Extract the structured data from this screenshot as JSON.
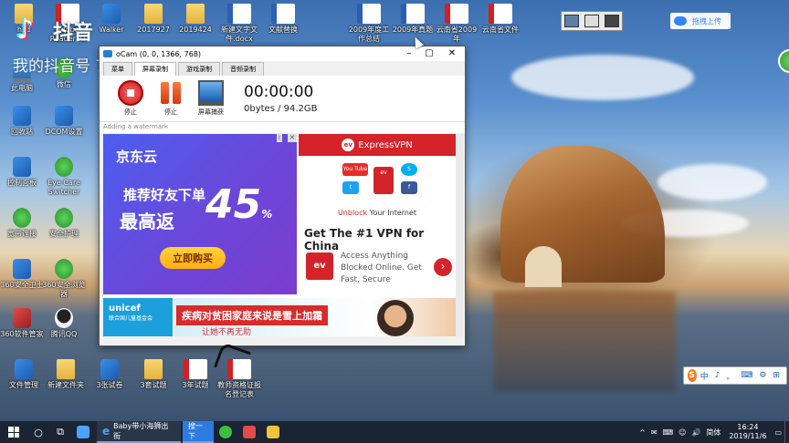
{
  "desktop": {
    "watermark": {
      "brand": "抖音",
      "id_line": "我的抖音号 7001030901"
    },
    "icons_row_top": [
      {
        "label": "hsd",
        "type": "folder"
      },
      {
        "label": "Adobe Reader XI",
        "type": "pdf"
      },
      {
        "label": "Walker",
        "type": "app"
      },
      {
        "label": "2017927",
        "type": "folder"
      },
      {
        "label": "2019424",
        "type": "folder"
      },
      {
        "label": "新建文字文件.docx",
        "type": "word"
      },
      {
        "label": "文献替换",
        "type": "word"
      },
      {
        "label": "2009年度工作总结",
        "type": "word"
      },
      {
        "label": "2009年真题",
        "type": "word"
      },
      {
        "label": "云南省2009年",
        "type": "pdf"
      },
      {
        "label": "云南省文件",
        "type": "pdf"
      }
    ],
    "icons_left_col": [
      {
        "label": "此电脑",
        "type": "pc"
      },
      {
        "label": "回收站",
        "type": "app"
      },
      {
        "label": "控制面板",
        "type": "app"
      },
      {
        "label": "宽带连接",
        "type": "green"
      },
      {
        "label": "360安全卫士",
        "type": "app"
      },
      {
        "label": "360软件管家",
        "type": "red"
      }
    ],
    "icons_second_col": [
      {
        "label": "微信",
        "type": "green"
      },
      {
        "label": "DCOM设置",
        "type": "app"
      },
      {
        "label": "Eye Care Switcher",
        "type": "green"
      },
      {
        "label": "安全护理",
        "type": "green"
      },
      {
        "label": "360安全浏览器",
        "type": "green"
      },
      {
        "label": "腾讯QQ",
        "type": "penguin"
      }
    ],
    "icons_bottom_row": [
      {
        "label": "文件管理",
        "type": "app"
      },
      {
        "label": "新建文件夹",
        "type": "folder"
      },
      {
        "label": "3张试卷",
        "type": "app"
      },
      {
        "label": "3套试题",
        "type": "folder"
      },
      {
        "label": "3年试题",
        "type": "pdf"
      },
      {
        "label": "教师资格证报名登记表",
        "type": "pdf"
      }
    ]
  },
  "ocam": {
    "title": "oCam (0, 0, 1366, 768)",
    "tabs": [
      "菜单",
      "屏幕录制",
      "游戏录制",
      "音频录制"
    ],
    "tools": [
      {
        "label": "停止",
        "icon": "stop-icon"
      },
      {
        "label": "停止",
        "icon": "pause-icon"
      },
      {
        "label": "屏幕捕获",
        "icon": "screen-capture-icon"
      }
    ],
    "timer": "00:00:00",
    "size": "0bytes / 94.2GB",
    "watermark_hint": "Adding a watermark"
  },
  "ads": {
    "jd": {
      "brand": "京东云",
      "line1": "推荐好友下单",
      "line2": "最高返",
      "percent": "45",
      "percent_sign": "%",
      "button": "立即购买"
    },
    "vpn": {
      "header": "ExpressVPN",
      "logo": "ev",
      "social": [
        "You Tube",
        "twitter",
        "skype",
        "facebook"
      ],
      "unblock_red": "Unblock",
      "unblock_rest": " Your Internet",
      "title": "Get The #1 VPN for China",
      "body": "Access Anything Blocked Online. Get Fast, Secure",
      "arrow": "›"
    },
    "unicef": {
      "name": "unicef",
      "sub": "联合国儿童基金会"
    },
    "charity": {
      "tag": "疾病对贫困家庭来说是雪上加霜",
      "sub": "让她不再无助"
    }
  },
  "top_right": {
    "baidu": "拖拽上传"
  },
  "ime": {
    "items": [
      "中",
      "♪",
      "。",
      "⌨",
      "⚙",
      "⊞"
    ]
  },
  "taskbar": {
    "search_icon": "○",
    "taskview_icon": "⧉",
    "ie_app": "Baby带小海狮出街",
    "blue_app": "搜一下",
    "tray_items": [
      "^",
      "✉",
      "⌨",
      "☺",
      "🔊",
      "简体"
    ],
    "time": "16:24",
    "date": "2019/11/6"
  },
  "colors": {
    "jd_bg": "#5a4fe0",
    "vpn_red": "#d5232a",
    "taskbar": "#1b2433"
  }
}
